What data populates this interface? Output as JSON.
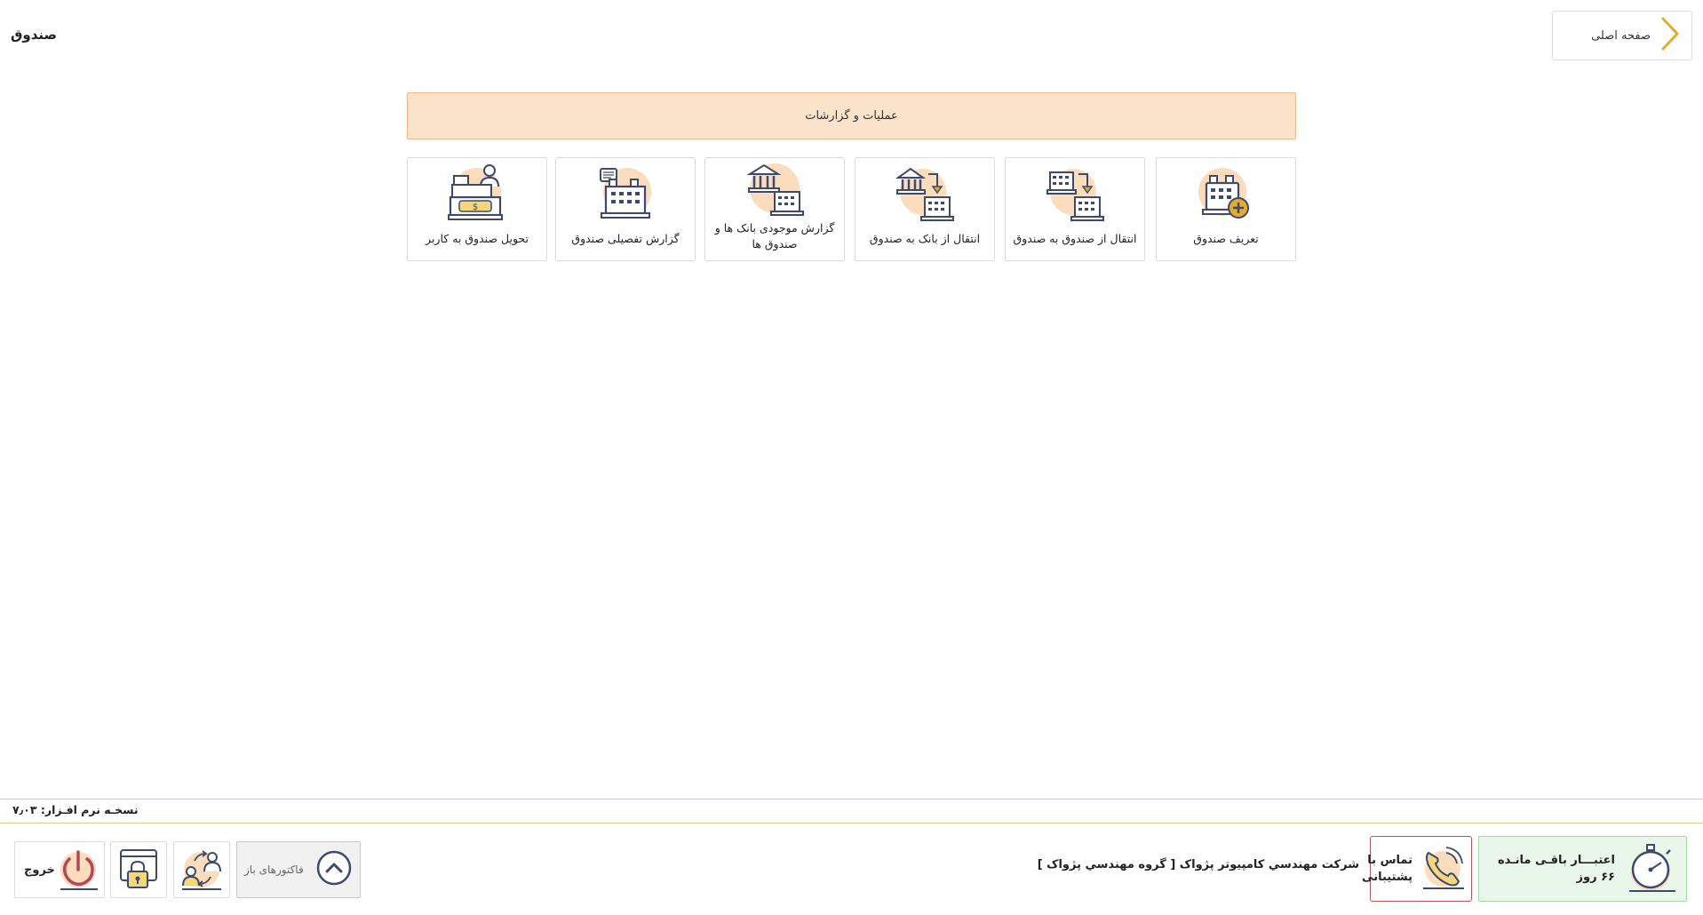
{
  "header": {
    "home_label": "صفحه اصلی",
    "page_title": "صندوق"
  },
  "section": {
    "title": "عملیات و گزارشات"
  },
  "tiles": [
    {
      "label": "تعریف صندوق",
      "icon": "cash-register-add-icon"
    },
    {
      "label": "انتقال از صندوق به صندوق",
      "icon": "register-to-register-icon"
    },
    {
      "label": "انتقال از بانک به صندوق",
      "icon": "bank-to-register-icon"
    },
    {
      "label": "گزارش موجودی بانک ها و صندوق ها",
      "icon": "bank-register-balance-icon"
    },
    {
      "label": "گزارش تفصیلی صندوق",
      "icon": "register-detail-report-icon"
    },
    {
      "label": "تحویل صندوق به کاربر",
      "icon": "register-handover-icon"
    }
  ],
  "footer": {
    "version": "نسخـه نرم افـزار: ۷٫۰۳",
    "credit_line1": "اعتبـــار باقـی مانـده",
    "credit_line2": "۶۶ روز",
    "support_line1": "تماس با",
    "support_line2": "پشتیبانی",
    "company": "شرکت مهندسي کامپيوتر پژواک [ گروه مهندسي پژواک ]",
    "open_invoices": "فاکتورهای باز",
    "exit": "خروج"
  },
  "colors": {
    "accent_gold": "#e3ac2a",
    "icon_blob": "#fbdcbc",
    "icon_stroke": "#3d4a6d",
    "section_bg": "#fbe3cb",
    "credit_bg": "#e9f6ea",
    "support_border": "#b3575e"
  }
}
